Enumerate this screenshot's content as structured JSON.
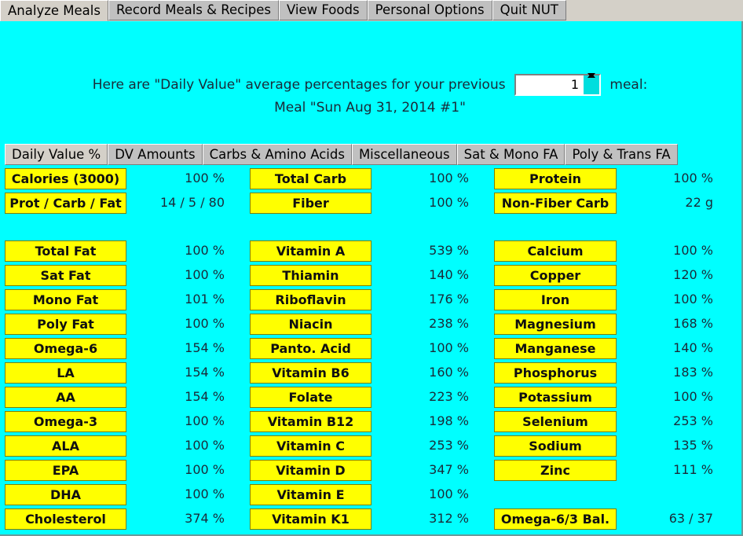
{
  "menubar": {
    "tabs": [
      {
        "label": "Analyze Meals",
        "selected": true
      },
      {
        "label": "Record Meals & Recipes",
        "selected": false
      },
      {
        "label": "View Foods",
        "selected": false
      },
      {
        "label": "Personal Options",
        "selected": false
      },
      {
        "label": "Quit NUT",
        "selected": false
      }
    ]
  },
  "header": {
    "text_before": "Here are \"Daily Value\" average percentages for your previous",
    "text_after": "meal:",
    "spinner_value": "1",
    "meal_title": "Meal \"Sun Aug 31, 2014 #1\""
  },
  "subtabs": {
    "tabs": [
      {
        "label": "Daily Value %",
        "selected": true
      },
      {
        "label": "DV Amounts",
        "selected": false
      },
      {
        "label": "Carbs & Amino Acids",
        "selected": false
      },
      {
        "label": "Miscellaneous",
        "selected": false
      },
      {
        "label": "Sat & Mono FA",
        "selected": false
      },
      {
        "label": "Poly & Trans FA",
        "selected": false
      }
    ]
  },
  "summary": {
    "col1": [
      {
        "label": "Calories (3000)",
        "value": "100 %"
      },
      {
        "label": "Prot / Carb / Fat",
        "value": "14 / 5 / 80"
      }
    ],
    "col2": [
      {
        "label": "Total Carb",
        "value": "100 %"
      },
      {
        "label": "Fiber",
        "value": "100 %"
      }
    ],
    "col3": [
      {
        "label": "Protein",
        "value": "100 %"
      },
      {
        "label": "Non-Fiber Carb",
        "value": "22 g"
      }
    ]
  },
  "nutrients": {
    "col1": [
      {
        "label": "Total Fat",
        "value": "100 %"
      },
      {
        "label": "Sat Fat",
        "value": "100 %"
      },
      {
        "label": "Mono Fat",
        "value": "101 %"
      },
      {
        "label": "Poly Fat",
        "value": "100 %"
      },
      {
        "label": "Omega-6",
        "value": "154 %"
      },
      {
        "label": "LA",
        "value": "154 %"
      },
      {
        "label": "AA",
        "value": "154 %"
      },
      {
        "label": "Omega-3",
        "value": "100 %"
      },
      {
        "label": "ALA",
        "value": "100 %"
      },
      {
        "label": "EPA",
        "value": "100 %"
      },
      {
        "label": "DHA",
        "value": "100 %"
      },
      {
        "label": "Cholesterol",
        "value": "374 %"
      }
    ],
    "col2": [
      {
        "label": "Vitamin A",
        "value": "539 %"
      },
      {
        "label": "Thiamin",
        "value": "140 %"
      },
      {
        "label": "Riboflavin",
        "value": "176 %"
      },
      {
        "label": "Niacin",
        "value": "238 %"
      },
      {
        "label": "Panto. Acid",
        "value": "100 %"
      },
      {
        "label": "Vitamin B6",
        "value": "160 %"
      },
      {
        "label": "Folate",
        "value": "223 %"
      },
      {
        "label": "Vitamin B12",
        "value": "198 %"
      },
      {
        "label": "Vitamin C",
        "value": "253 %"
      },
      {
        "label": "Vitamin D",
        "value": "347 %"
      },
      {
        "label": "Vitamin E",
        "value": "100 %"
      },
      {
        "label": "Vitamin K1",
        "value": "312 %"
      }
    ],
    "col3": [
      {
        "label": "Calcium",
        "value": "100 %"
      },
      {
        "label": "Copper",
        "value": "120 %"
      },
      {
        "label": "Iron",
        "value": "100 %"
      },
      {
        "label": "Magnesium",
        "value": "168 %"
      },
      {
        "label": "Manganese",
        "value": "140 %"
      },
      {
        "label": "Phosphorus",
        "value": "183 %"
      },
      {
        "label": "Potassium",
        "value": "100 %"
      },
      {
        "label": "Selenium",
        "value": "253 %"
      },
      {
        "label": "Sodium",
        "value": "135 %"
      },
      {
        "label": "Zinc",
        "value": "111 %"
      },
      {
        "label": "",
        "value": ""
      },
      {
        "label": "Omega-6/3 Bal.",
        "value": "63 / 37"
      }
    ]
  },
  "colors": {
    "background": "#00ffff",
    "cell_fill": "#ffff00",
    "cell_border": "#808000",
    "chrome": "#c0c0c0",
    "chrome_selected": "#d4d0c8"
  }
}
